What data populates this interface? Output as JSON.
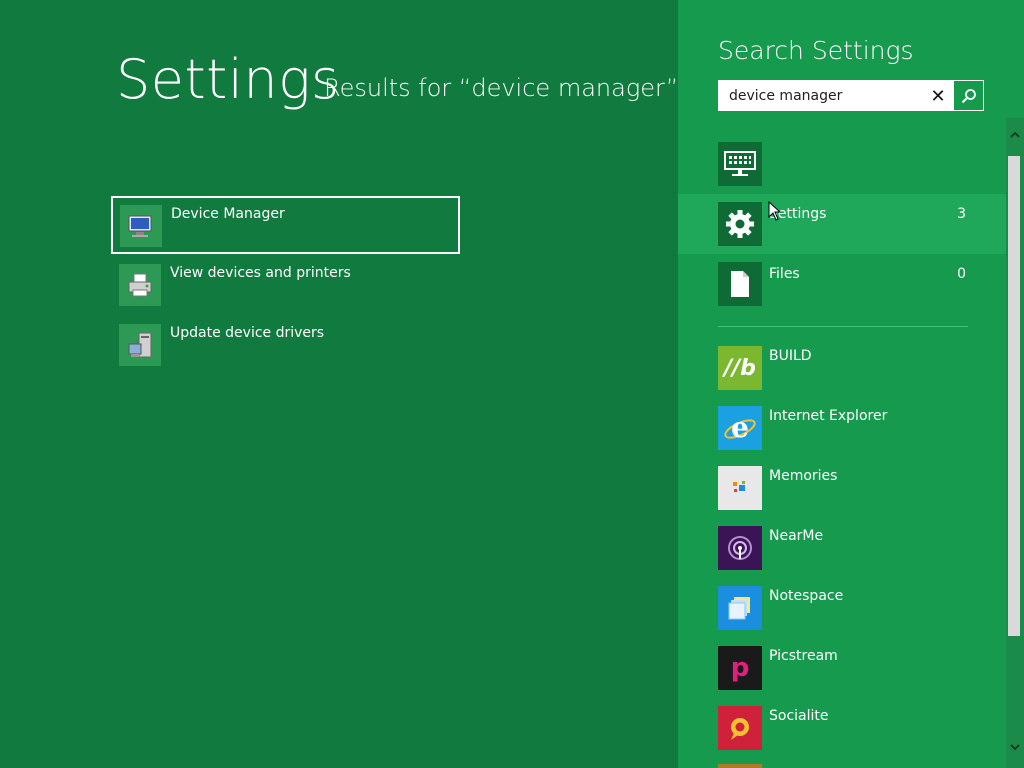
{
  "main": {
    "title": "Settings",
    "subtitle": "Results for “device manager”",
    "results": [
      {
        "label": "Device Manager",
        "icon": "device-manager-icon",
        "selected": true
      },
      {
        "label": "View devices and printers",
        "icon": "printer-icon",
        "selected": false
      },
      {
        "label": "Update device drivers",
        "icon": "driver-install-icon",
        "selected": false
      }
    ]
  },
  "pane": {
    "title": "Search Settings",
    "search": {
      "value": "device manager",
      "placeholder": ""
    },
    "scopes": [
      {
        "label": "",
        "count": "",
        "icon": "keyboard-icon"
      },
      {
        "label": "Settings",
        "count": "3",
        "icon": "gear-icon"
      },
      {
        "label": "Files",
        "count": "0",
        "icon": "file-icon"
      }
    ],
    "apps": [
      {
        "label": "BUILD",
        "icon": "build-app-icon",
        "color": "#7cb82f"
      },
      {
        "label": "Internet Explorer",
        "icon": "internet-explorer-icon",
        "color": "#1ba1e2"
      },
      {
        "label": "Memories",
        "icon": "memories-app-icon",
        "color": "#e8e8e8"
      },
      {
        "label": "NearMe",
        "icon": "nearme-app-icon",
        "color": "#3a1454"
      },
      {
        "label": "Notespace",
        "icon": "notespace-app-icon",
        "color": "#1b8ee0"
      },
      {
        "label": "Picstream",
        "icon": "picstream-app-icon",
        "color": "#1a1a1a"
      },
      {
        "label": "Socialite",
        "icon": "socialite-app-icon",
        "color": "#d0213b"
      }
    ]
  },
  "colors": {
    "background": "#117a3f",
    "pane": "#159a4e",
    "active_scope": "#1fa85a"
  }
}
